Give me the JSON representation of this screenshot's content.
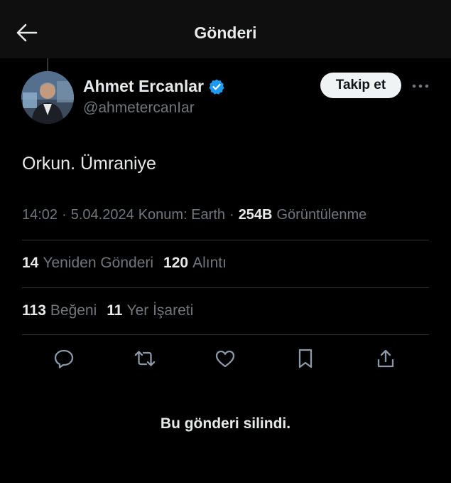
{
  "header": {
    "title": "Gönderi",
    "back_icon": "arrow-left-icon"
  },
  "author": {
    "name": "Ahmet Ercanlar",
    "handle": "@ahmetercanIar",
    "verified_color": "#1d9bf0",
    "follow_label": "Takip et",
    "more_icon": "more-dots-icon"
  },
  "tweet": {
    "text": "Orkun. Ümraniye"
  },
  "meta": {
    "time": "14:02",
    "sep1": "·",
    "date": "5.04.2024",
    "location": "Konum: Earth",
    "sep2": "·",
    "views_count": "254B",
    "views_label": "Görüntülenme"
  },
  "stats": {
    "reposts_count": "14",
    "reposts_label": "Yeniden Gönderi",
    "quotes_count": "120",
    "quotes_label": "Alıntı",
    "likes_count": "113",
    "likes_label": "Beğeni",
    "bookmarks_count": "11",
    "bookmarks_label": "Yer İşareti"
  },
  "actions": [
    "reply-icon",
    "retweet-icon",
    "heart-icon",
    "bookmark-icon",
    "share-icon"
  ],
  "notice": "Bu gönderi silindi.",
  "colors": {
    "background": "#000000",
    "header_bg": "#0f0f0f",
    "text_primary": "#e7e9ea",
    "text_secondary": "#71767b",
    "divider": "#2f3336",
    "follow_bg": "#eff3f4"
  }
}
